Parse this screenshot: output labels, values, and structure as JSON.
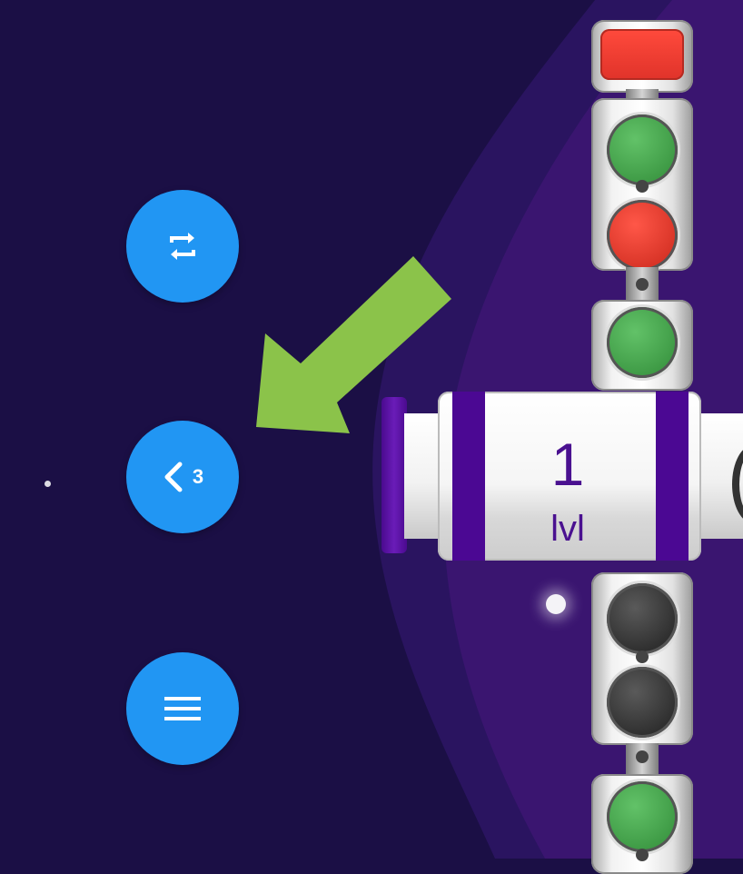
{
  "colors": {
    "background": "#1b0f45",
    "blob_inner": "#3a1570",
    "button": "#2196f3",
    "arrow": "#8bc34a",
    "barrel_stripe": "#4b0893",
    "level_text": "#4a1190"
  },
  "sidebar": {
    "swap_button": {
      "icon": "swap-arrows-icon"
    },
    "undo_button": {
      "icon": "chevron-left-icon",
      "count": "3"
    },
    "menu_button": {
      "icon": "hamburger-menu-icon"
    }
  },
  "annotation": {
    "icon": "arrow-pointer-icon"
  },
  "level": {
    "number": "1",
    "label": "lvl"
  },
  "traffic_column": {
    "lights": [
      "red-cap",
      "green",
      "red",
      "green",
      "off",
      "off",
      "green"
    ]
  }
}
